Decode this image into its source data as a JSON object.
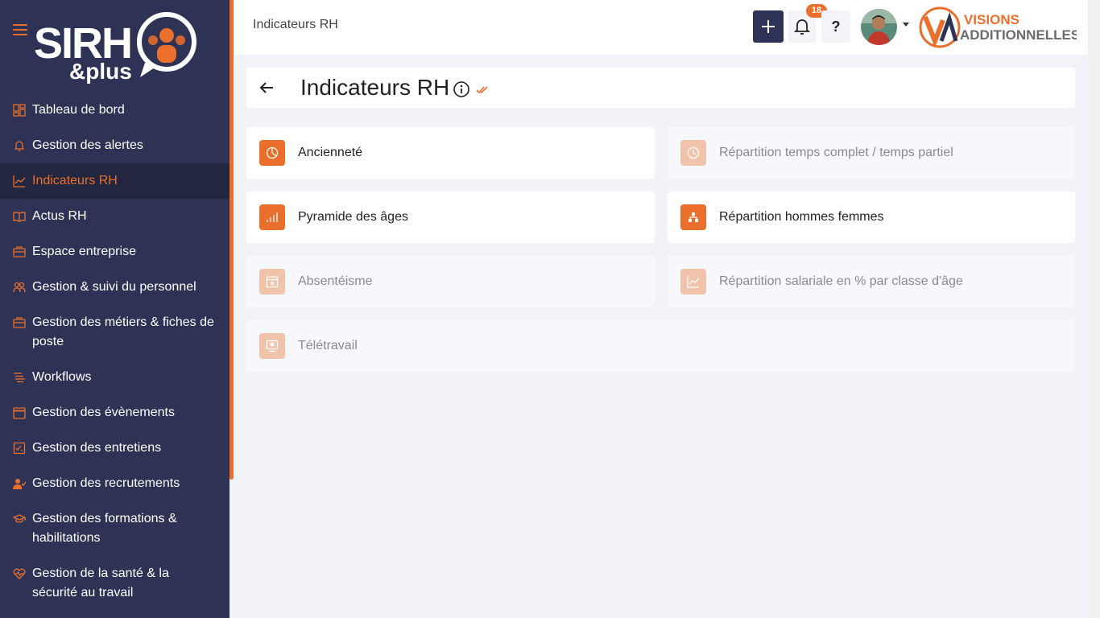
{
  "brand": {
    "logo_text_main": "SIRH",
    "logo_text_sub": "&plus",
    "accent_color": "#ea6e2c",
    "sidebar_color": "#2e3356"
  },
  "sidebar": {
    "items": [
      {
        "label": "Tableau de bord",
        "icon": "dashboard-icon"
      },
      {
        "label": "Gestion des alertes",
        "icon": "bell-icon"
      },
      {
        "label": "Indicateurs RH",
        "icon": "line-chart-icon",
        "active": true
      },
      {
        "label": "Actus RH",
        "icon": "book-icon"
      },
      {
        "label": "Espace entreprise",
        "icon": "briefcase-icon"
      },
      {
        "label": "Gestion & suivi du personnel",
        "icon": "users-icon"
      },
      {
        "label": "Gestion des métiers & fiches de poste",
        "icon": "briefcase-icon"
      },
      {
        "label": "Workflows",
        "icon": "list-icon"
      },
      {
        "label": "Gestion des évènements",
        "icon": "calendar-icon"
      },
      {
        "label": "Gestion des entretiens",
        "icon": "checklist-icon"
      },
      {
        "label": "Gestion des recrutements",
        "icon": "user-check-icon"
      },
      {
        "label": "Gestion des formations & habilitations",
        "icon": "graduation-cap-icon"
      },
      {
        "label": "Gestion de la santé & la sécurité au travail",
        "icon": "heart-pulse-icon"
      }
    ]
  },
  "topbar": {
    "breadcrumb": "Indicateurs RH",
    "notification_count": "18",
    "help_label": "?",
    "partner_logo_line1": "VISIONS",
    "partner_logo_line2": "ADDITIONNELLES"
  },
  "page": {
    "title": "Indicateurs RH"
  },
  "indicators": [
    {
      "label": "Ancienneté",
      "icon": "pie-chart-icon",
      "enabled": true
    },
    {
      "label": "Répartition temps complet / temps partiel",
      "icon": "clock-icon",
      "enabled": false
    },
    {
      "label": "Pyramide des âges",
      "icon": "bar-chart-icon",
      "enabled": true
    },
    {
      "label": "Répartition hommes femmes",
      "icon": "hierarchy-icon",
      "enabled": true
    },
    {
      "label": "Absentéisme",
      "icon": "calendar-x-icon",
      "enabled": false
    },
    {
      "label": "Répartition salariale en % par classe d'âge",
      "icon": "line-chart-icon",
      "enabled": false
    },
    {
      "label": "Télétravail",
      "icon": "remote-work-icon",
      "enabled": false
    }
  ]
}
